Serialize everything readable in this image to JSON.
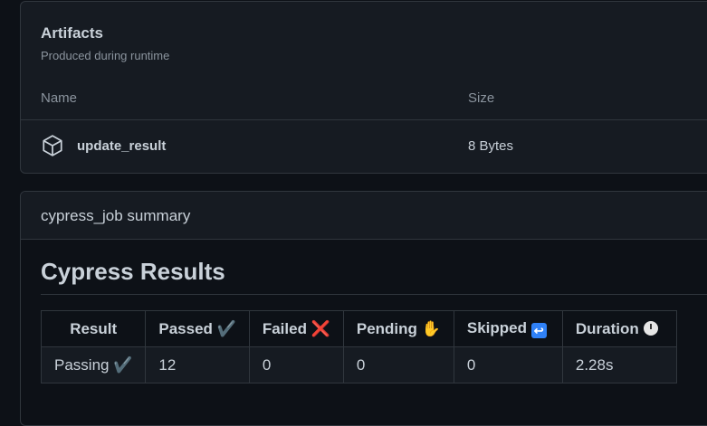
{
  "artifacts": {
    "title": "Artifacts",
    "subtitle": "Produced during runtime",
    "columns": {
      "name": "Name",
      "size": "Size"
    },
    "items": [
      {
        "icon": "package-icon",
        "name": "update_result",
        "size": "8 Bytes"
      }
    ]
  },
  "summary": {
    "title": "cypress_job summary",
    "heading": "Cypress Results",
    "table": {
      "headers": [
        {
          "label": "Result",
          "emoji": ""
        },
        {
          "label": "Passed",
          "emoji": "✔️"
        },
        {
          "label": "Failed",
          "emoji": "❌"
        },
        {
          "label": "Pending",
          "emoji": "✋"
        },
        {
          "label": "Skipped",
          "emoji": "↩"
        },
        {
          "label": "Duration",
          "emoji": "🕐"
        }
      ],
      "rows": [
        {
          "result": "Passing",
          "result_emoji": "✔️",
          "passed": "12",
          "failed": "0",
          "pending": "0",
          "skipped": "0",
          "duration": "2.28s"
        }
      ]
    }
  },
  "colors": {
    "background": "#0d1117",
    "panel": "#161b22",
    "border": "#30363d",
    "text": "#c9d1d9",
    "muted": "#8b949e"
  }
}
